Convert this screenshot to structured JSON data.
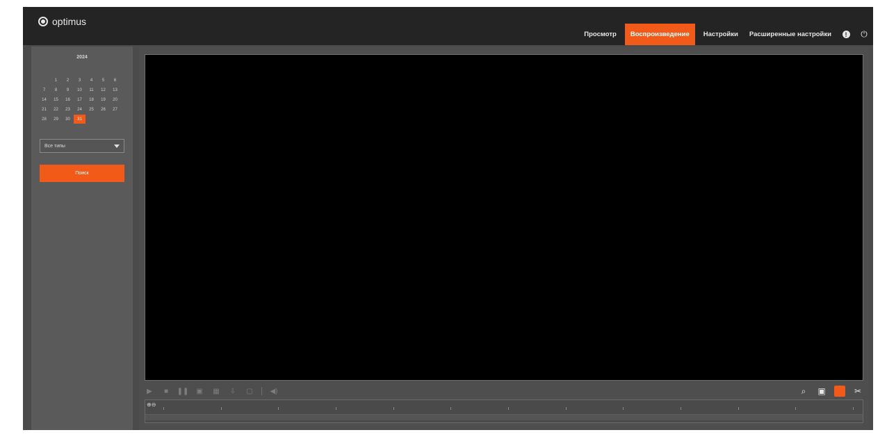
{
  "logo": {
    "text": "optimus"
  },
  "nav": {
    "items": [
      {
        "label": "Просмотр",
        "active": false
      },
      {
        "label": "Воспроизведение",
        "active": true
      },
      {
        "label": "Настройки",
        "active": false
      },
      {
        "label": "Расширенные настройки",
        "active": false
      }
    ],
    "icons": [
      "info-icon",
      "power-icon"
    ]
  },
  "calendar": {
    "year": "2024",
    "month": "",
    "weekdays": [
      "",
      "",
      "",
      "",
      "",
      "",
      ""
    ],
    "days": [
      "",
      "1",
      "2",
      "3",
      "4",
      "5",
      "6",
      "7",
      "8",
      "9",
      "10",
      "11",
      "12",
      "13",
      "14",
      "15",
      "16",
      "17",
      "18",
      "19",
      "20",
      "21",
      "22",
      "23",
      "24",
      "25",
      "26",
      "27",
      "28",
      "29",
      "30",
      "31"
    ],
    "selected_day": "31"
  },
  "record_type": {
    "value": "Все типы"
  },
  "search": {
    "label": "Поиск"
  },
  "controls": {
    "left": [
      "play-icon",
      "stop-icon",
      "pause-icon",
      "snapshot-icon",
      "clip-icon",
      "download-icon",
      "frame-icon",
      "divider",
      "volume-icon"
    ],
    "right": [
      "zoom-icon",
      "fullscreen-icon",
      "record-indicator-icon",
      "cut-icon"
    ]
  },
  "timeline": {
    "ticks": [
      "",
      "",
      "",
      "",
      "",
      "",
      "",
      "",
      "",
      "",
      "",
      "",
      ""
    ]
  },
  "colors": {
    "accent": "#f25a19",
    "topbar": "#242424",
    "panel": "#4b4b4b"
  }
}
